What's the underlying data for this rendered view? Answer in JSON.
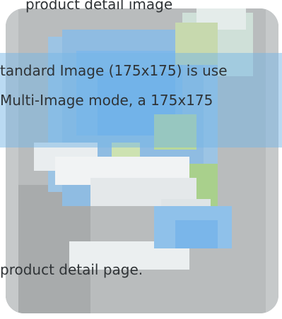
{
  "text": {
    "line_top": "product detail image",
    "line1": "tandard Image (175x175) is use",
    "line2": "Multi-Image mode, a 175x175",
    "line3": "product detail page."
  },
  "colors": {
    "highlight": "#76b5e6",
    "card_background": "#b9bcbd",
    "text": "#2f3336"
  },
  "image": {
    "icon": "globe-ie-style-pixelated-icon"
  }
}
